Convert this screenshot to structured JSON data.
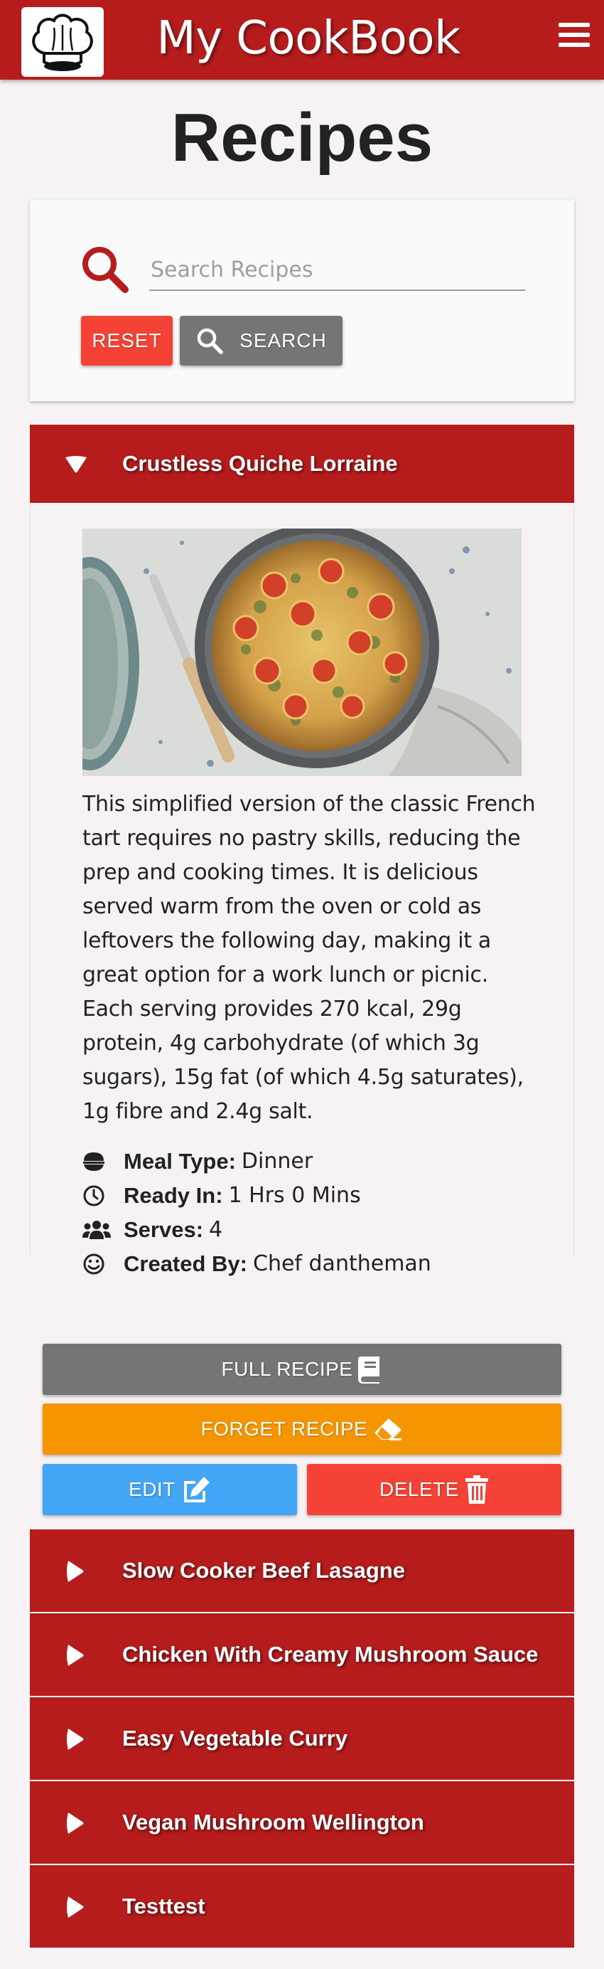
{
  "navbar": {
    "brand": "My CookBook",
    "logo_icon": "chef-hat-icon",
    "menu_icon": "hamburger-menu-icon",
    "color": "#b71c1c"
  },
  "page": {
    "title": "Recipes"
  },
  "search": {
    "placeholder": "Search Recipes",
    "value": "",
    "reset_label": "Reset",
    "search_label": "Search"
  },
  "expanded_recipe": {
    "title": "Crustless Quiche Lorraine",
    "image_alt": "Crustless quiche with tomatoes in a round dish",
    "description": "This simplified version of the classic French tart requires no pastry skills, reducing the prep and cooking times. It is delicious served warm from the oven or cold as leftovers the following day, making it a great option for a work lunch or picnic. Each serving provides 270 kcal, 29g protein, 4g carbohydrate (of which 3g sugars), 15g fat (of which 4.5g saturates), 1g fibre and 2.4g salt.",
    "meta": {
      "meal_type_label": "Meal Type:",
      "meal_type_value": "Dinner",
      "ready_in_label": "Ready In:",
      "ready_in_value": "1 Hrs 0 Mins",
      "serves_label": "Serves:",
      "serves_value": "4",
      "created_by_label": "Created By:",
      "created_by_value": "Chef dantheman"
    },
    "actions": {
      "full_recipe": "Full Recipe",
      "forget_recipe": "Forget Recipe",
      "edit": "Edit",
      "delete": "Delete"
    }
  },
  "recipes": [
    {
      "title": "Slow Cooker Beef Lasagne"
    },
    {
      "title": "Chicken With Creamy Mushroom Sauce"
    },
    {
      "title": "Easy Vegetable Curry"
    },
    {
      "title": "Vegan Mushroom Wellington"
    },
    {
      "title": "Testtest"
    }
  ],
  "colors": {
    "primary": "#b71c1c",
    "reset": "#f44336",
    "grey": "#757575",
    "orange": "#f59600",
    "blue": "#42a5f5",
    "red": "#f44336"
  }
}
